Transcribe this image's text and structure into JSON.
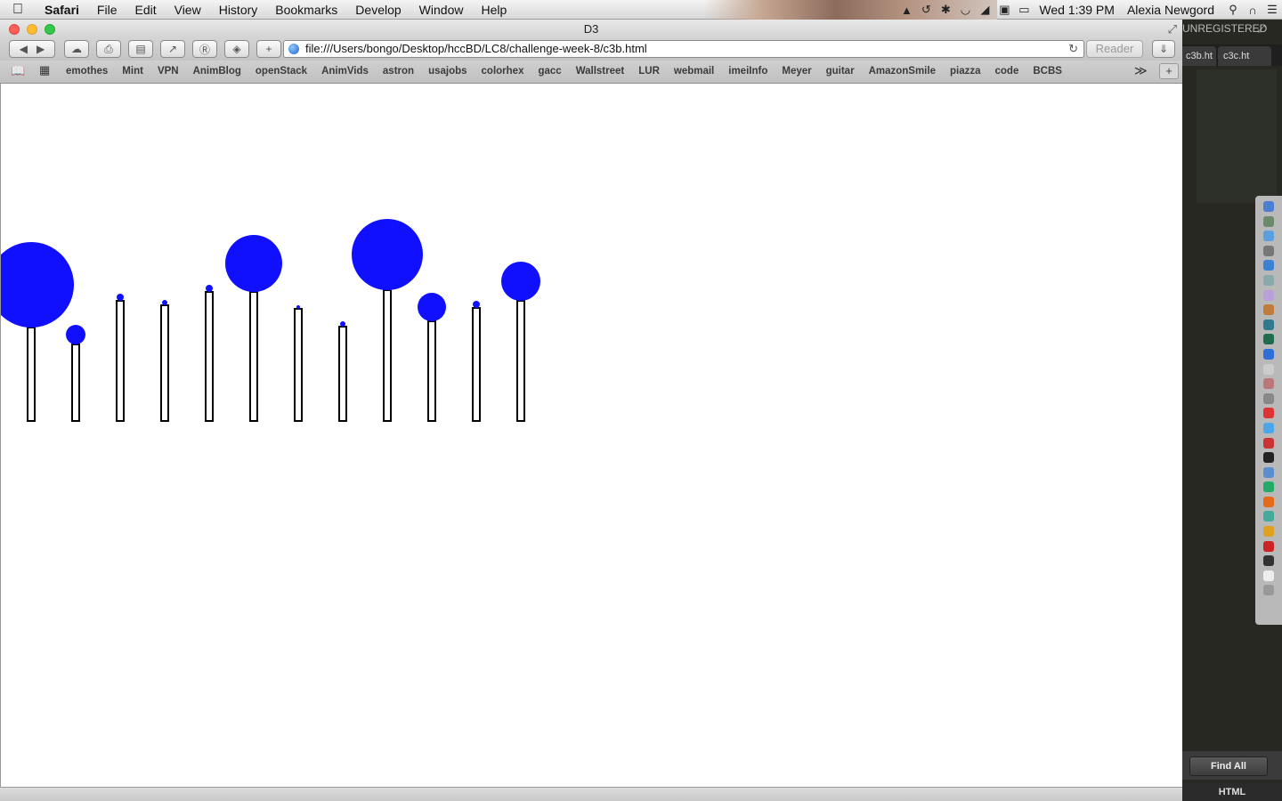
{
  "menubar": {
    "apple_icon": "apple-logo-icon",
    "app_name": "Safari",
    "menus": [
      "File",
      "Edit",
      "View",
      "History",
      "Bookmarks",
      "Develop",
      "Window",
      "Help"
    ],
    "status_icons": [
      "evernote-icon",
      "time-machine-icon",
      "bluetooth-icon",
      "wifi-icon",
      "volume-icon",
      "keyboard-input-icon",
      "battery-icon"
    ],
    "clock": "Wed 1:39 PM",
    "user": "Alexia Newgord",
    "search_icon": "spotlight-search-icon",
    "notification_icon": "notification-center-icon"
  },
  "window": {
    "title": "D3",
    "url": "file:///Users/bongo/Desktop/hccBD/LC8/challenge-week-8/c3b.html",
    "reader_label": "Reader",
    "bookmarks": [
      "emothes",
      "Mint",
      "VPN",
      "AnimBlog",
      "openStack",
      "AnimVids",
      "astron",
      "usajobs",
      "colorhex",
      "gacc",
      "Wallstreet",
      "LUR",
      "webmail",
      "imeiInfo",
      "Meyer",
      "guitar",
      "AmazonSmile",
      "piazza",
      "code",
      "BCBS"
    ],
    "more_bookmarks_label": "≫",
    "add_tab_label": "+"
  },
  "visualization": {
    "bar_stroke": "#000000",
    "circle_fill": "#1010ff",
    "items": [
      {
        "bar_height": 105,
        "circle_r": 48
      },
      {
        "bar_height": 86,
        "circle_r": 11
      },
      {
        "bar_height": 135,
        "circle_r": 4
      },
      {
        "bar_height": 130,
        "circle_r": 3
      },
      {
        "bar_height": 145,
        "circle_r": 4
      },
      {
        "bar_height": 145,
        "circle_r": 32
      },
      {
        "bar_height": 126,
        "circle_r": 2
      },
      {
        "bar_height": 106,
        "circle_r": 3
      },
      {
        "bar_height": 147,
        "circle_r": 40
      },
      {
        "bar_height": 112,
        "circle_r": 16
      },
      {
        "bar_height": 127,
        "circle_r": 4
      },
      {
        "bar_height": 135,
        "circle_r": 22
      }
    ]
  },
  "editor": {
    "unregistered_label": "UNREGISTERED",
    "tabs": [
      "c3b.ht",
      "c3c.ht"
    ],
    "find_all_label": "Find All",
    "syntax_label": "HTML"
  },
  "colors": {
    "accent": "#1010ff",
    "editor_bg": "#272822"
  }
}
